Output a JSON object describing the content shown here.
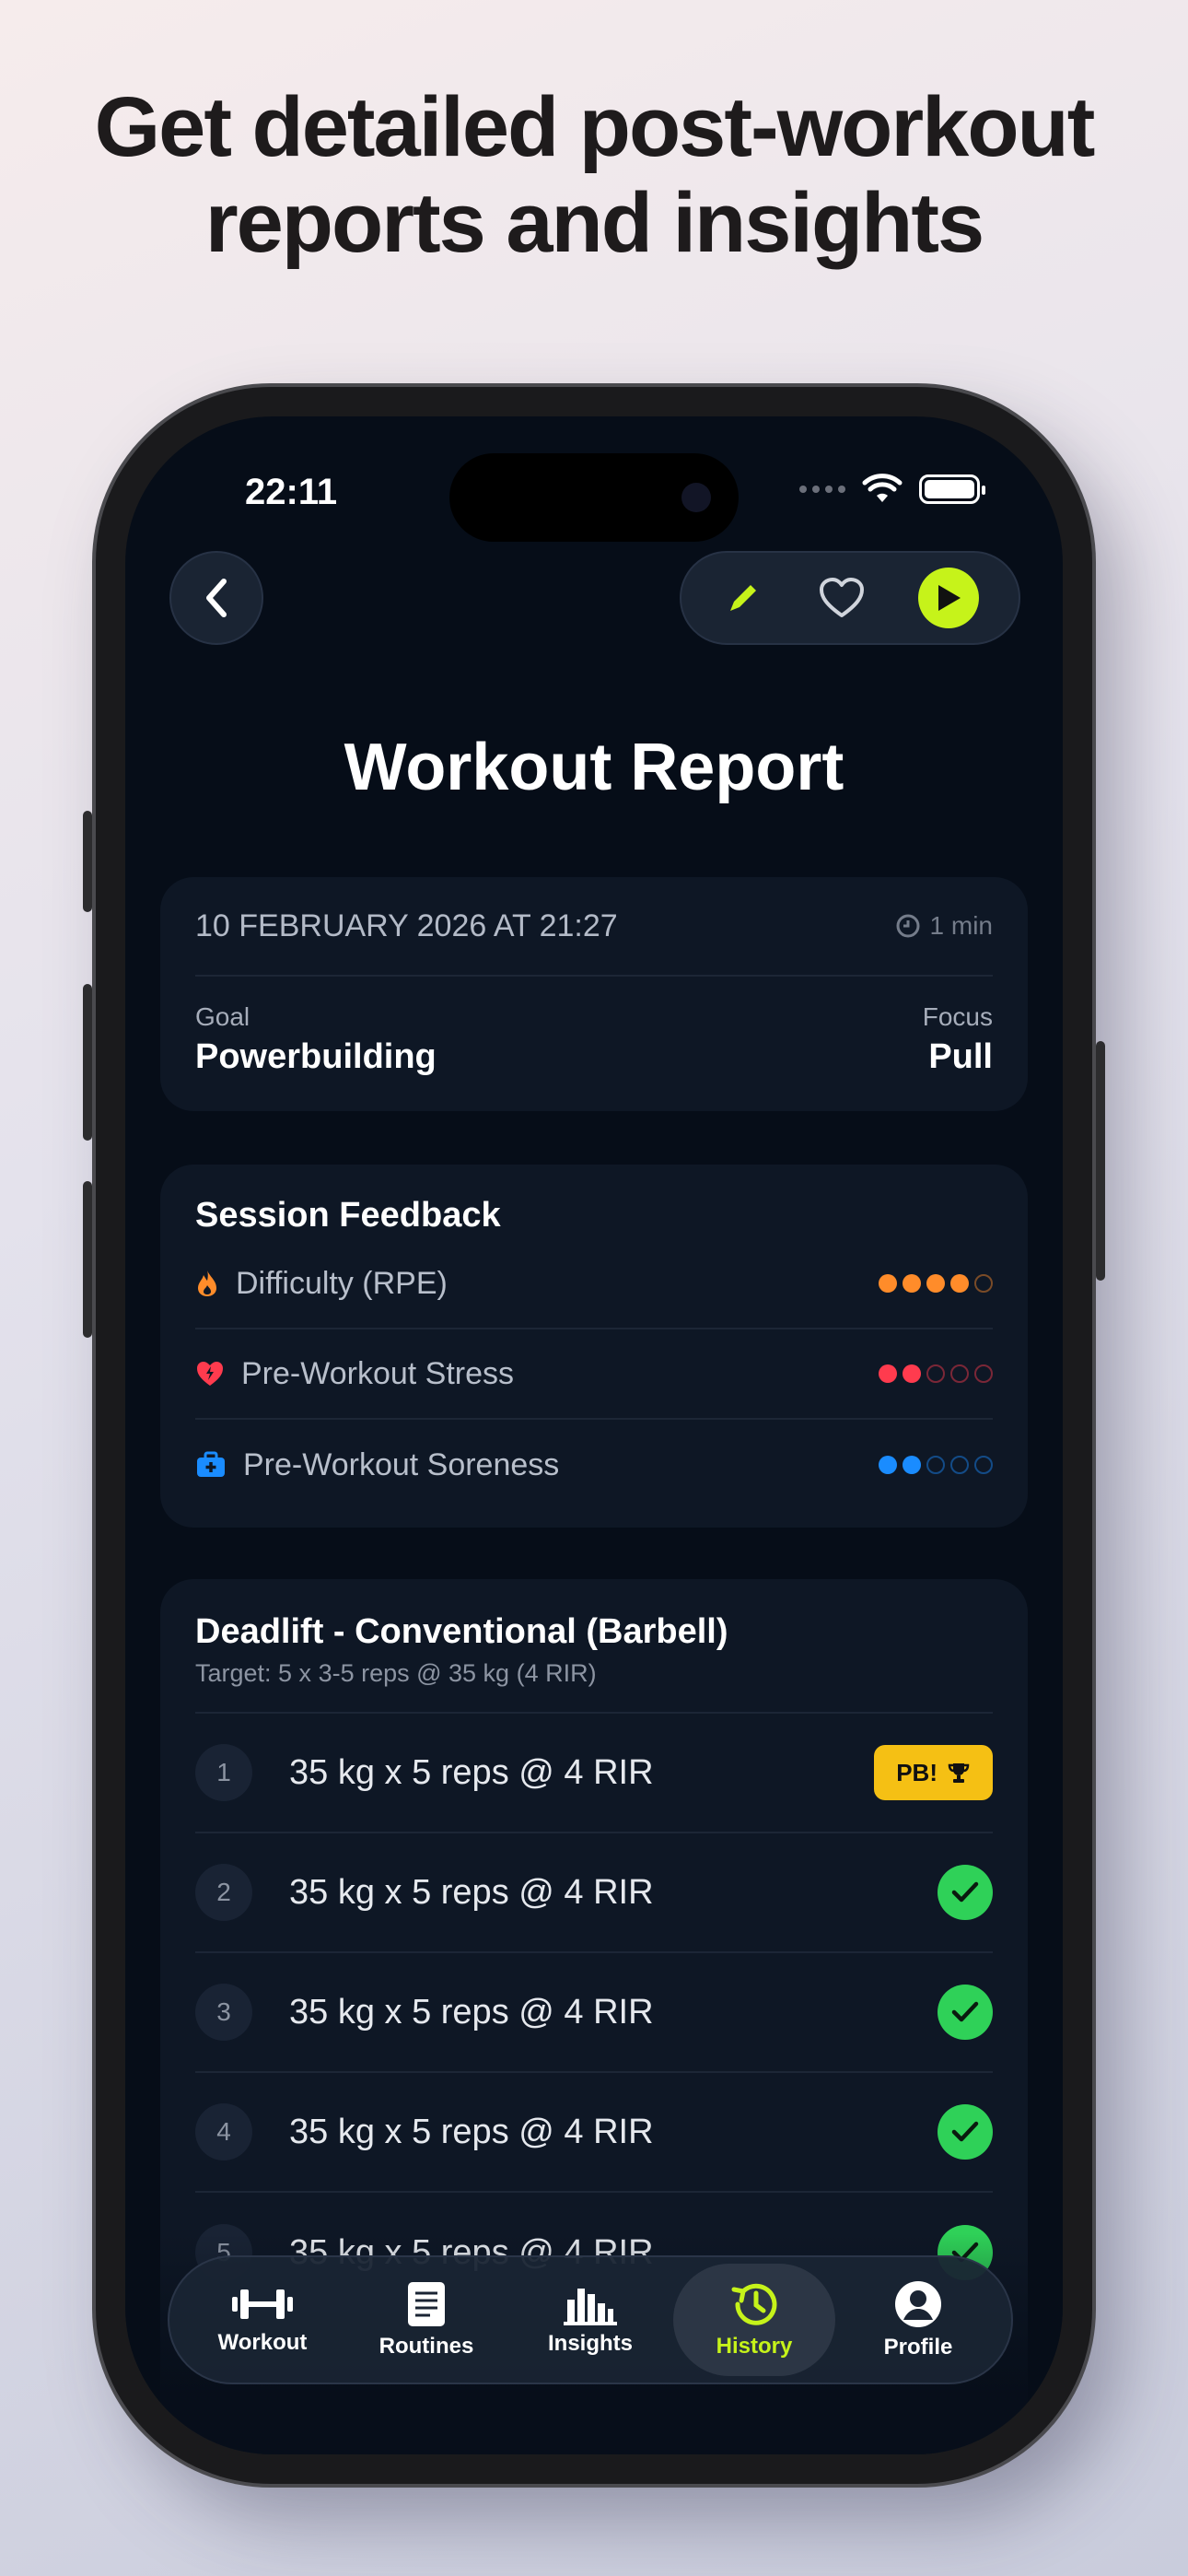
{
  "headline": "Get detailed post-workout reports and insights",
  "status": {
    "time": "22:11"
  },
  "header": {
    "title": "Workout Report"
  },
  "summary": {
    "date": "10 FEBRUARY 2026 AT 21:27",
    "duration": "1 min",
    "goal_label": "Goal",
    "goal_value": "Powerbuilding",
    "focus_label": "Focus",
    "focus_value": "Pull"
  },
  "feedback": {
    "title": "Session Feedback",
    "items": [
      {
        "label": "Difficulty (RPE)",
        "icon": "flame-icon",
        "rating": 4,
        "max": 5,
        "color": "#ff8c2a"
      },
      {
        "label": "Pre-Workout Stress",
        "icon": "heart-bolt-icon",
        "rating": 2,
        "max": 5,
        "color": "#ff3b4e"
      },
      {
        "label": "Pre-Workout Soreness",
        "icon": "medkit-icon",
        "rating": 2,
        "max": 5,
        "color": "#1a8cff"
      }
    ]
  },
  "exercise": {
    "name": "Deadlift - Conventional (Barbell)",
    "target": "Target: 5 x 3-5 reps @ 35 kg (4 RIR)",
    "sets": [
      {
        "num": "1",
        "text": "35 kg x 5 reps @ 4 RIR",
        "badge": "PB!"
      },
      {
        "num": "2",
        "text": "35 kg x 5 reps @ 4 RIR"
      },
      {
        "num": "3",
        "text": "35 kg x 5 reps @ 4 RIR"
      },
      {
        "num": "4",
        "text": "35 kg x 5 reps @ 4 RIR"
      },
      {
        "num": "5",
        "text": "35 kg x 5 reps @ 4 RIR"
      }
    ]
  },
  "tabs": [
    {
      "label": "Workout",
      "icon": "dumbbell-icon"
    },
    {
      "label": "Routines",
      "icon": "clipboard-icon"
    },
    {
      "label": "Insights",
      "icon": "bar-chart-icon"
    },
    {
      "label": "History",
      "icon": "history-icon",
      "active": true
    },
    {
      "label": "Profile",
      "icon": "profile-icon"
    }
  ],
  "colors": {
    "accent": "#c6f31a",
    "success": "#2fd158",
    "pb": "#f5c014",
    "background": "#060d18"
  }
}
